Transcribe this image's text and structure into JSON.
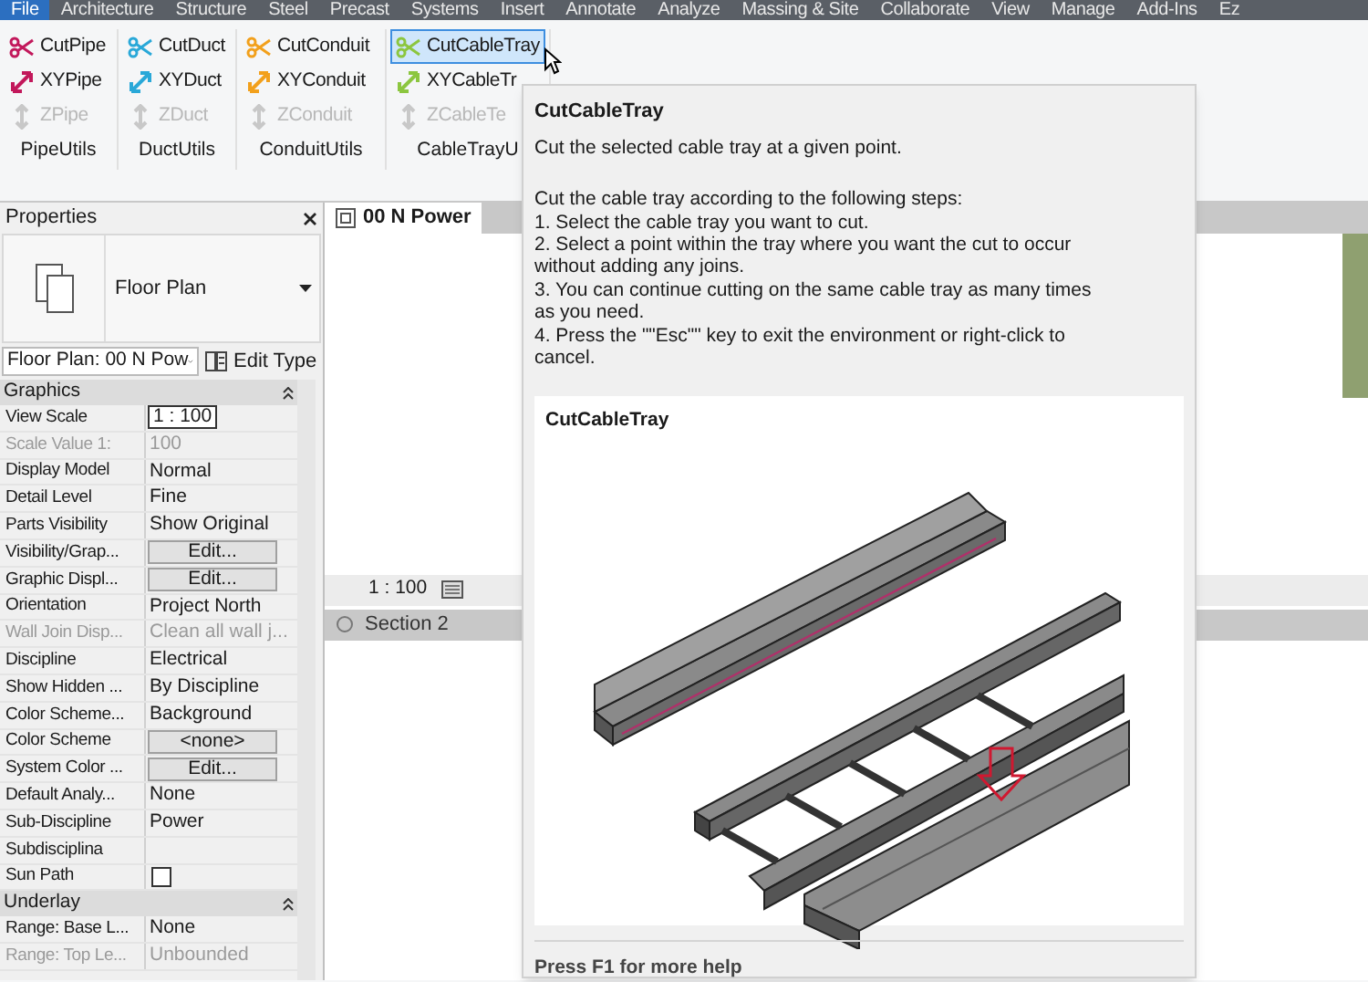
{
  "menu": [
    {
      "label": "File",
      "selected": true
    },
    {
      "label": "Architecture",
      "selected": false
    },
    {
      "label": "Structure",
      "selected": false
    },
    {
      "label": "Steel",
      "selected": false
    },
    {
      "label": "Precast",
      "selected": false
    },
    {
      "label": "Systems",
      "selected": false
    },
    {
      "label": "Insert",
      "selected": false
    },
    {
      "label": "Annotate",
      "selected": false
    },
    {
      "label": "Analyze",
      "selected": false
    },
    {
      "label": "Massing & Site",
      "selected": false
    },
    {
      "label": "Collaborate",
      "selected": false
    },
    {
      "label": "View",
      "selected": false
    },
    {
      "label": "Manage",
      "selected": false
    },
    {
      "label": "Add-Ins",
      "selected": false
    },
    {
      "label": "Ez",
      "selected": false
    }
  ],
  "ribbon_groups": [
    {
      "label": "PipeUtils",
      "color": "#c2185b",
      "tools": [
        {
          "label": "CutPipe",
          "kind": "cut",
          "disabled": false,
          "selected": false
        },
        {
          "label": "XYPipe",
          "kind": "xy",
          "disabled": false,
          "selected": false
        },
        {
          "label": "ZPipe",
          "kind": "z",
          "disabled": true,
          "selected": false
        }
      ]
    },
    {
      "label": "DuctUtils",
      "color": "#29a8d8",
      "tools": [
        {
          "label": "CutDuct",
          "kind": "cut",
          "disabled": false,
          "selected": false
        },
        {
          "label": "XYDuct",
          "kind": "xy",
          "disabled": false,
          "selected": false
        },
        {
          "label": "ZDuct",
          "kind": "z",
          "disabled": true,
          "selected": false
        }
      ]
    },
    {
      "label": "ConduitUtils",
      "color": "#f2a01c",
      "tools": [
        {
          "label": "CutConduit",
          "kind": "cut",
          "disabled": false,
          "selected": false
        },
        {
          "label": "XYConduit",
          "kind": "xy",
          "disabled": false,
          "selected": false
        },
        {
          "label": "ZConduit",
          "kind": "z",
          "disabled": true,
          "selected": false
        }
      ]
    },
    {
      "label": "CableTrayU",
      "color": "#8cc63f",
      "tools": [
        {
          "label": "CutCableTray",
          "kind": "cut",
          "disabled": false,
          "selected": true
        },
        {
          "label": "XYCableTr",
          "kind": "xy",
          "disabled": false,
          "selected": false
        },
        {
          "label": "ZCableTe",
          "kind": "z",
          "disabled": true,
          "selected": false
        }
      ]
    }
  ],
  "properties": {
    "title": "Properties",
    "type_name": "Floor Plan",
    "instance_selector": "Floor Plan: 00 N Pow",
    "edit_type": "Edit Type",
    "sections": [
      {
        "title": "Graphics",
        "rows": [
          {
            "label": "View Scale",
            "value": "1 : 100",
            "kind": "field",
            "disabled": false
          },
          {
            "label": "Scale Value    1:",
            "value": "100",
            "kind": "text",
            "disabled": true
          },
          {
            "label": "Display Model",
            "value": "Normal",
            "kind": "text",
            "disabled": false
          },
          {
            "label": "Detail Level",
            "value": "Fine",
            "kind": "text",
            "disabled": false
          },
          {
            "label": "Parts Visibility",
            "value": "Show Original",
            "kind": "text",
            "disabled": false
          },
          {
            "label": "Visibility/Grap...",
            "value": "Edit...",
            "kind": "button",
            "disabled": false
          },
          {
            "label": "Graphic Displ...",
            "value": "Edit...",
            "kind": "button",
            "disabled": false
          },
          {
            "label": "Orientation",
            "value": "Project North",
            "kind": "text",
            "disabled": false
          },
          {
            "label": "Wall Join Disp...",
            "value": "Clean all wall j...",
            "kind": "text",
            "disabled": true
          },
          {
            "label": "Discipline",
            "value": "Electrical",
            "kind": "text",
            "disabled": false
          },
          {
            "label": "Show Hidden ...",
            "value": "By Discipline",
            "kind": "text",
            "disabled": false
          },
          {
            "label": "Color Scheme...",
            "value": "Background",
            "kind": "text",
            "disabled": false
          },
          {
            "label": "Color Scheme",
            "value": "<none>",
            "kind": "button",
            "disabled": false
          },
          {
            "label": "System Color ...",
            "value": "Edit...",
            "kind": "button",
            "disabled": false
          },
          {
            "label": "Default Analy...",
            "value": "None",
            "kind": "text",
            "disabled": false
          },
          {
            "label": "Sub-Discipline",
            "value": "Power",
            "kind": "text",
            "disabled": false
          },
          {
            "label": "Subdisciplina",
            "kind": "text",
            "disabled": false
          },
          {
            "label": "Sun Path",
            "kind": "checkbox",
            "checked": false,
            "disabled": false
          }
        ]
      },
      {
        "title": "Underlay",
        "rows": [
          {
            "label": "Range: Base L...",
            "value": "None",
            "kind": "text",
            "disabled": false
          },
          {
            "label": "Range: Top Le...",
            "value": "Unbounded",
            "kind": "text",
            "disabled": true
          }
        ]
      }
    ]
  },
  "views": [
    {
      "title": "00 N Power",
      "scale": "1 : 100"
    },
    {
      "title": "Section 2"
    }
  ],
  "tooltip": {
    "title": "CutCableTray",
    "summary": "Cut the selected cable tray at a given point.",
    "steps": "Cut the cable tray according to the following steps:\n1. Select the cable tray you want to cut.\n2. Select a point within the tray where you want the cut to occur without adding any joins.\n3. You can continue cutting on the same cable tray as many times as you need.\n4. Press the \"\"Esc\"\" key to exit the environment or right-click to cancel.",
    "image_title": "CutCableTray",
    "footer": "Press F1 for more help"
  }
}
